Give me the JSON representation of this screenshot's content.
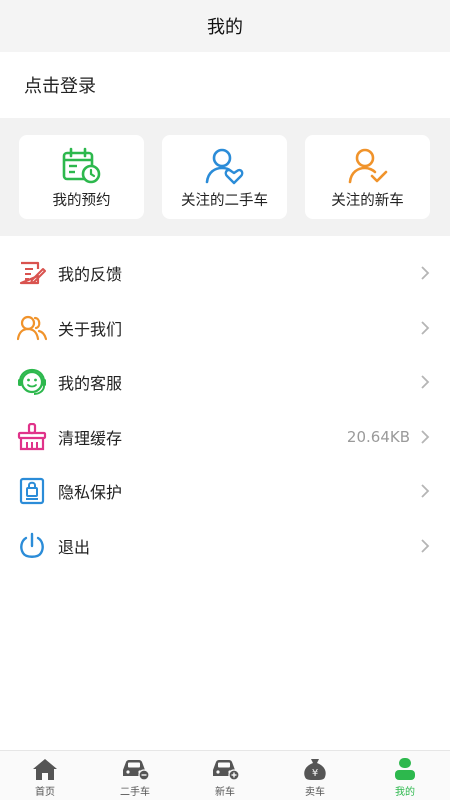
{
  "header": {
    "title": "我的"
  },
  "login": {
    "label": "点击登录"
  },
  "quick_cards": [
    {
      "label": "我的预约",
      "icon": "calendar-clock-icon",
      "color": "#2db84d"
    },
    {
      "label": "关注的二手车",
      "icon": "user-heart-icon",
      "color": "#2b8cd8"
    },
    {
      "label": "关注的新车",
      "icon": "user-check-icon",
      "color": "#f0932b"
    }
  ],
  "menu": [
    {
      "label": "我的反馈",
      "icon": "feedback-icon",
      "color": "#d9534f",
      "extra": ""
    },
    {
      "label": "关于我们",
      "icon": "users-icon",
      "color": "#f0932b",
      "extra": ""
    },
    {
      "label": "我的客服",
      "icon": "customer-service-icon",
      "color": "#2db84d",
      "extra": ""
    },
    {
      "label": "清理缓存",
      "icon": "broom-icon",
      "color": "#e0338a",
      "extra": "20.64KB"
    },
    {
      "label": "隐私保护",
      "icon": "privacy-lock-icon",
      "color": "#2b8cd8",
      "extra": ""
    },
    {
      "label": "退出",
      "icon": "power-icon",
      "color": "#2b8cd8",
      "extra": ""
    }
  ],
  "tabs": [
    {
      "label": "首页",
      "icon": "home-icon",
      "active": false
    },
    {
      "label": "二手车",
      "icon": "used-car-icon",
      "active": false
    },
    {
      "label": "新车",
      "icon": "new-car-icon",
      "active": false
    },
    {
      "label": "卖车",
      "icon": "money-bag-icon",
      "active": false
    },
    {
      "label": "我的",
      "icon": "profile-icon",
      "active": true
    }
  ],
  "colors": {
    "accent": "#2db84d",
    "inactive_tab": "#555555"
  }
}
